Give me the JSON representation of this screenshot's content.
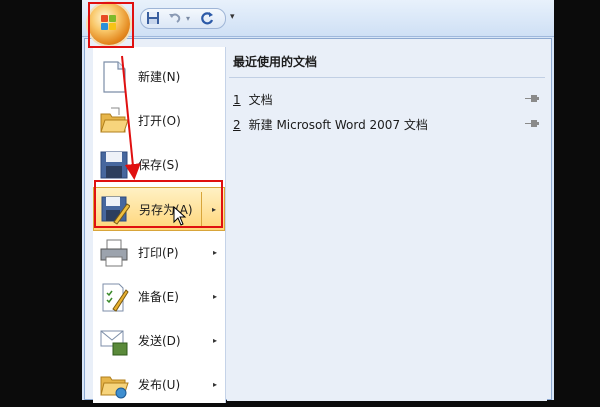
{
  "qat": {
    "office_button_icon": "office-logo-icon",
    "save_icon": "save-icon",
    "undo_icon": "undo-icon",
    "undo_dropdown_icon": "dropdown-arrow-icon",
    "redo_icon": "redo-icon",
    "customize_icon": "customize-qat-icon"
  },
  "menu": {
    "items": [
      {
        "label": "新建(N)",
        "icon": "new-document-icon",
        "has_submenu": false
      },
      {
        "label": "打开(O)",
        "icon": "open-folder-icon",
        "has_submenu": false
      },
      {
        "label": "保存(S)",
        "icon": "save-icon",
        "has_submenu": false
      },
      {
        "label": "另存为(A)",
        "icon": "save-as-icon",
        "has_submenu": true,
        "highlighted": true
      },
      {
        "label": "打印(P)",
        "icon": "printer-icon",
        "has_submenu": true
      },
      {
        "label": "准备(E)",
        "icon": "prepare-icon",
        "has_submenu": true
      },
      {
        "label": "发送(D)",
        "icon": "send-icon",
        "has_submenu": true
      },
      {
        "label": "发布(U)",
        "icon": "publish-icon",
        "has_submenu": true
      }
    ],
    "submenu_arrow": "▸"
  },
  "recent": {
    "title": "最近使用的文档",
    "items": [
      {
        "num": "1",
        "name": "文档",
        "pin_icon": "pin-icon"
      },
      {
        "num": "2",
        "name": "新建 Microsoft Word 2007 文档",
        "pin_icon": "pin-icon"
      }
    ]
  },
  "annotation": {
    "color": "#e01010"
  },
  "colors": {
    "highlight": "#ffd67a",
    "menu_bg": "#e9eff8",
    "border": "#8da9d1"
  }
}
